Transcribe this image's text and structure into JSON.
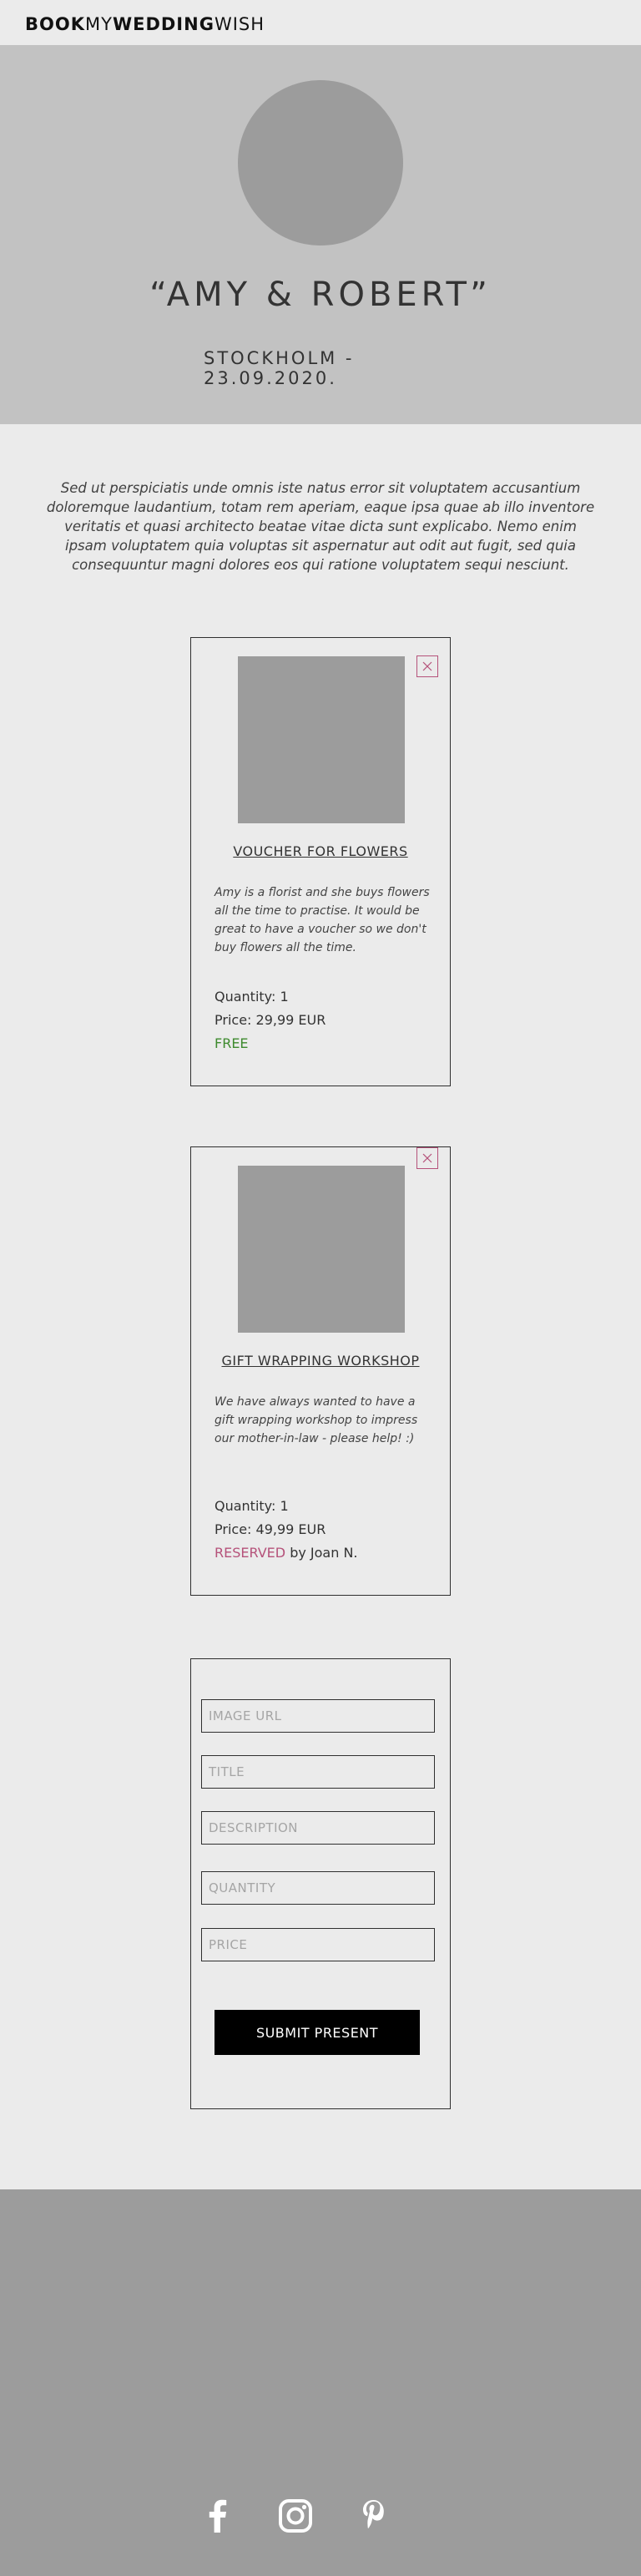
{
  "header": {
    "logo": {
      "part1": "BOOK",
      "part2": "MY",
      "part3": "WEDDING",
      "part4": "WISH"
    }
  },
  "hero": {
    "couple": "“AMY & ROBERT”",
    "place_date": "STOCKHOLM - 23.09.2020."
  },
  "intro": "Sed ut perspiciatis unde omnis iste natus error sit voluptatem accusantium doloremque laudantium, totam rem aperiam, eaque ipsa quae ab illo inventore veritatis et quasi architecto beatae vitae dicta sunt explicabo. Nemo enim ipsam voluptatem quia voluptas sit aspernatur aut odit aut fugit, sed quia consequuntur magni dolores eos qui ratione voluptatem sequi nesciunt.",
  "presents": [
    {
      "title": "VOUCHER FOR FLOWERS",
      "description": "Amy is a florist and she buys flowers all the time to practise. It would be great to have a voucher so we don't buy flowers all the time.",
      "quantity": "Quantity: 1",
      "price": "Price: 29,99 EUR",
      "status": "FREE",
      "reserved_by": ""
    },
    {
      "title": "GIFT WRAPPING WORKSHOP",
      "description": "We have always wanted to have a gift wrapping workshop to impress our mother-in-law - please help! :)",
      "quantity": "Quantity: 1",
      "price": "Price: 49,99 EUR",
      "status": "RESERVED",
      "reserved_by": " by Joan N."
    }
  ],
  "form": {
    "image_url_placeholder": "IMAGE URL",
    "title_placeholder": "TITLE",
    "description_placeholder": "DESCRIPTION",
    "quantity_placeholder": "QUANTITY",
    "price_placeholder": "PRICE",
    "submit_label": "SUBMIT PRESENT"
  },
  "footer": {
    "icons": [
      "facebook-icon",
      "instagram-icon",
      "pinterest-icon"
    ]
  },
  "colors": {
    "free": "#3e8a2e",
    "reserved": "#b5527a",
    "hero_bg": "#c2c2c2",
    "footer_bg": "#9c9c9c"
  }
}
